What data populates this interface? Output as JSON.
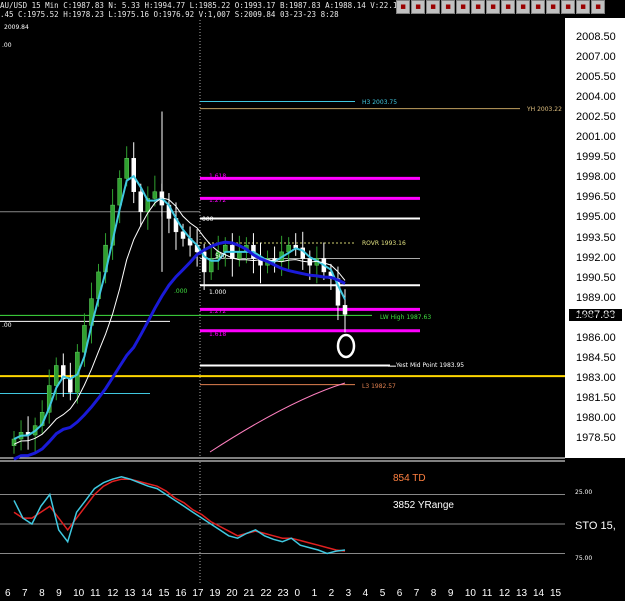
{
  "header": {
    "line1": "AU/USD 15 Min  C:1987.83  N:  5.33  H:1994.77  L:1985.22  O:1993.17  B:1987.83  A:1988.14  V:22.1K",
    "line2": ".45  C:1975.52  H:1978.23  L:1975.16  O:1976.92  V:1,007  S:2009.84  03-23-23  8:28",
    "left_label_top": ".00",
    "left_label_mid": "2009.84",
    "left_label_low": ".00"
  },
  "price_axis": {
    "ticks": [
      "2008.50",
      "2007.00",
      "2005.50",
      "2004.00",
      "2002.50",
      "2001.00",
      "1999.50",
      "1998.00",
      "1996.50",
      "1995.00",
      "1993.50",
      "1992.00",
      "1990.50",
      "1989.00",
      "1987.50",
      "1986.00",
      "1984.50",
      "1983.00",
      "1981.50",
      "1980.00",
      "1978.50"
    ],
    "current_price": "1987.83"
  },
  "x_axis": {
    "ticks": [
      "6",
      "7",
      "8",
      "9",
      "10",
      "11",
      "12",
      "13",
      "14",
      "15",
      "16",
      "17",
      "19",
      "20",
      "21",
      "22",
      "23",
      "0",
      "1",
      "2",
      "3",
      "4",
      "5",
      "6",
      "7",
      "8",
      "9",
      "10",
      "11",
      "12",
      "13",
      "14",
      "15"
    ]
  },
  "annotations": {
    "h3": "H3  2003.75",
    "yh": "YH  2003.22",
    "fib1618_top": "1.618",
    "fib1272_top": "1.272",
    "fib000": "000",
    "rovr": "ROVR  1993.16",
    "fib500": "500",
    "fib_left000": ".000",
    "fib1000": "1.000",
    "fib1272_low": "1.272",
    "lw_high": "LW High  1987.63",
    "fib1618_low": "1.618",
    "yest_mid": "Yest Mid Point  1983.95",
    "l3": "L3  1982.57"
  },
  "oscillator": {
    "td_label": "854 TD",
    "yrange_label": "3852 YRange",
    "sto_label": "STO  15,",
    "level_high": "25.00",
    "level_low": "75.00"
  },
  "colors": {
    "background": "#000000",
    "magenta": "#ff00ff",
    "white": "#ffffff",
    "cyan": "#40c8e0",
    "blue": "#1a1ad8",
    "green_candle": "#30a030",
    "gold": "#ffd700",
    "pink": "#ff80c0",
    "stoch_fast": "#40c8e0",
    "stoch_slow": "#e02020"
  },
  "chart_data": {
    "type": "line",
    "title": "",
    "xlabel": "",
    "ylabel": "",
    "ylim": [
      1977.5,
      2009.3
    ],
    "price_levels": [
      {
        "label": "H3 2003.75",
        "value": 2003.75
      },
      {
        "label": "YH 2003.22",
        "value": 2003.22
      },
      {
        "label": "1.618",
        "value": 1998.0
      },
      {
        "label": "1.272",
        "value": 1996.5
      },
      {
        "label": "000",
        "value": 1995.0
      },
      {
        "label": "ROVR 1993.16",
        "value": 1993.16
      },
      {
        "label": "500",
        "value": 1992.0
      },
      {
        "label": "1.000",
        "value": 1990.0
      },
      {
        "label": "1.272",
        "value": 1988.2
      },
      {
        "label": "LW High 1987.63",
        "value": 1987.63
      },
      {
        "label": "1.618",
        "value": 1986.6
      },
      {
        "label": "Yest Mid Point 1983.95",
        "value": 1983.95
      },
      {
        "label": "L3 1982.57",
        "value": 1982.57
      }
    ],
    "close_series": [
      1978.5,
      1979.0,
      1978.8,
      1979.5,
      1980.5,
      1982.5,
      1984.0,
      1983.0,
      1982.0,
      1985.0,
      1987.0,
      1989.0,
      1991.0,
      1993.0,
      1996.0,
      1998.0,
      1999.5,
      1997.0,
      1995.5,
      1996.5,
      1997.0,
      1996.0,
      1995.0,
      1994.0,
      1993.5,
      1993.0,
      1992.5,
      1991.0,
      1992.0,
      1992.5,
      1993.0,
      1992.0,
      1992.5,
      1993.0,
      1992.0,
      1991.5,
      1992.0,
      1991.8,
      1992.5,
      1993.0,
      1992.8,
      1992.0,
      1991.5,
      1992.0,
      1991.0,
      1990.5,
      1988.5,
      1987.83
    ],
    "stoch_fast": [
      30,
      45,
      50,
      35,
      25,
      55,
      65,
      40,
      30,
      20,
      15,
      12,
      10,
      12,
      15,
      18,
      20,
      25,
      30,
      35,
      40,
      45,
      50,
      55,
      60,
      62,
      58,
      55,
      60,
      63,
      65,
      62,
      68,
      70,
      72,
      75,
      73,
      72
    ],
    "stoch_slow": [
      40,
      45,
      45,
      40,
      35,
      45,
      55,
      45,
      35,
      25,
      18,
      14,
      12,
      12,
      14,
      16,
      18,
      22,
      28,
      32,
      38,
      42,
      48,
      52,
      56,
      60,
      58,
      56,
      58,
      60,
      62,
      62,
      64,
      66,
      68,
      70,
      72,
      73
    ],
    "osc_ylim": [
      0,
      100
    ]
  }
}
